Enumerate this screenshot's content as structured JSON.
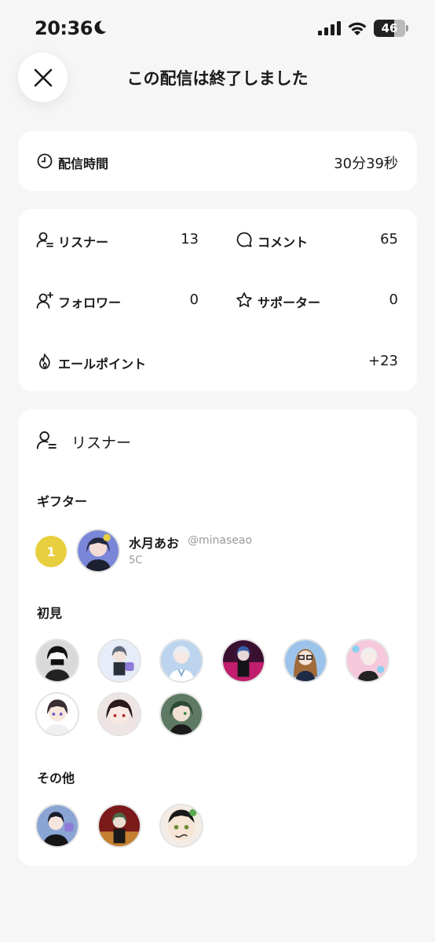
{
  "status_bar": {
    "time": "20:36",
    "battery": "46"
  },
  "header": {
    "title": "この配信は終了しました"
  },
  "duration": {
    "label": "配信時間",
    "value": "30分39秒"
  },
  "stats": {
    "listeners": {
      "label": "リスナー",
      "value": "13"
    },
    "comments": {
      "label": "コメント",
      "value": "65"
    },
    "followers": {
      "label": "フォロワー",
      "value": "0"
    },
    "supporters": {
      "label": "サポーター",
      "value": "0"
    },
    "cheer_points": {
      "label": "エールポイント",
      "value": "+23"
    }
  },
  "listeners_section": {
    "title": "リスナー",
    "gifters": {
      "title": "ギフター",
      "items": [
        {
          "rank": "1",
          "name": "水月あお",
          "handle": "@minaseao",
          "amount": "5C"
        }
      ]
    },
    "first_time": {
      "title": "初見",
      "count": 9
    },
    "others": {
      "title": "その他",
      "count": 3
    }
  },
  "colors": {
    "rank_gold": "#e8cf3f",
    "background": "#f6f6f6",
    "card": "#ffffff"
  },
  "icons": [
    "moon-icon",
    "signal-icon",
    "wifi-icon",
    "close-icon",
    "clock-icon",
    "person-list-icon",
    "speech-bubble-icon",
    "person-add-icon",
    "star-icon",
    "flame-icon"
  ]
}
